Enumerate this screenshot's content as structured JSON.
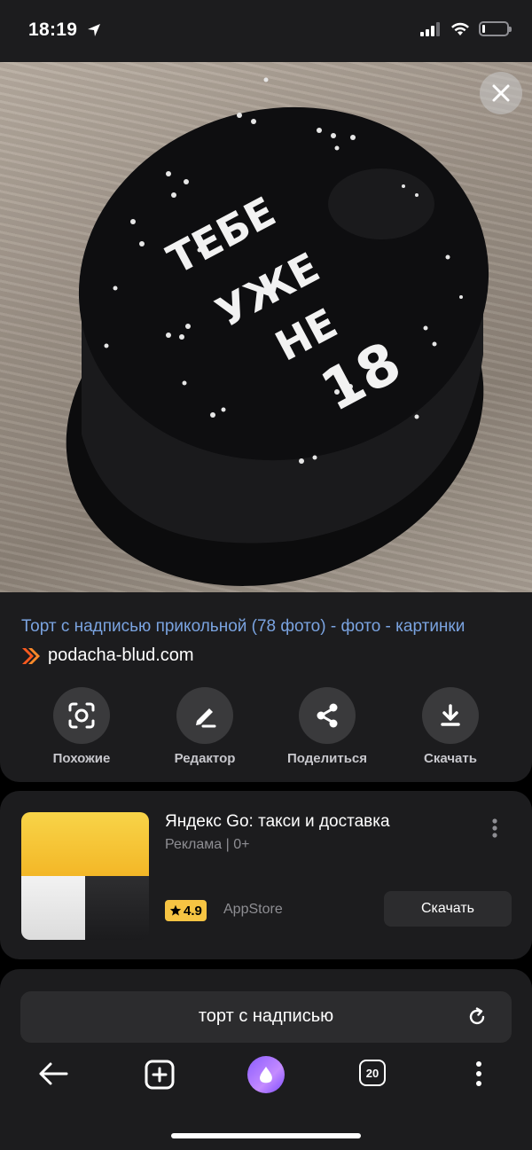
{
  "status_bar": {
    "time": "18:19",
    "battery_level": 0.12
  },
  "result": {
    "title": "Торт с надписью прикольной (78 фото) - фото - картинки",
    "source": "podacha-blud.com",
    "cake_inscription": [
      "ТЕБЕ",
      "УЖЕ",
      "НЕ",
      "18"
    ]
  },
  "actions": [
    {
      "label": "Похожие",
      "icon": "lens-icon"
    },
    {
      "label": "Редактор",
      "icon": "pencil-icon"
    },
    {
      "label": "Поделиться",
      "icon": "share-icon"
    },
    {
      "label": "Скачать",
      "icon": "download-icon"
    }
  ],
  "ad": {
    "title": "Яндекс Go: такси и доставка",
    "subtitle": "Реклама | 0+",
    "rating": "4.9",
    "store": "AppStore",
    "button": "Скачать"
  },
  "search": {
    "query": "торт с надписью"
  },
  "nav": {
    "tabs_count": "20"
  },
  "colors": {
    "link": "#7aa3e0",
    "card": "#1c1c1e",
    "rating_badge": "#f6c443",
    "source_logo": "#ff5a1f"
  }
}
